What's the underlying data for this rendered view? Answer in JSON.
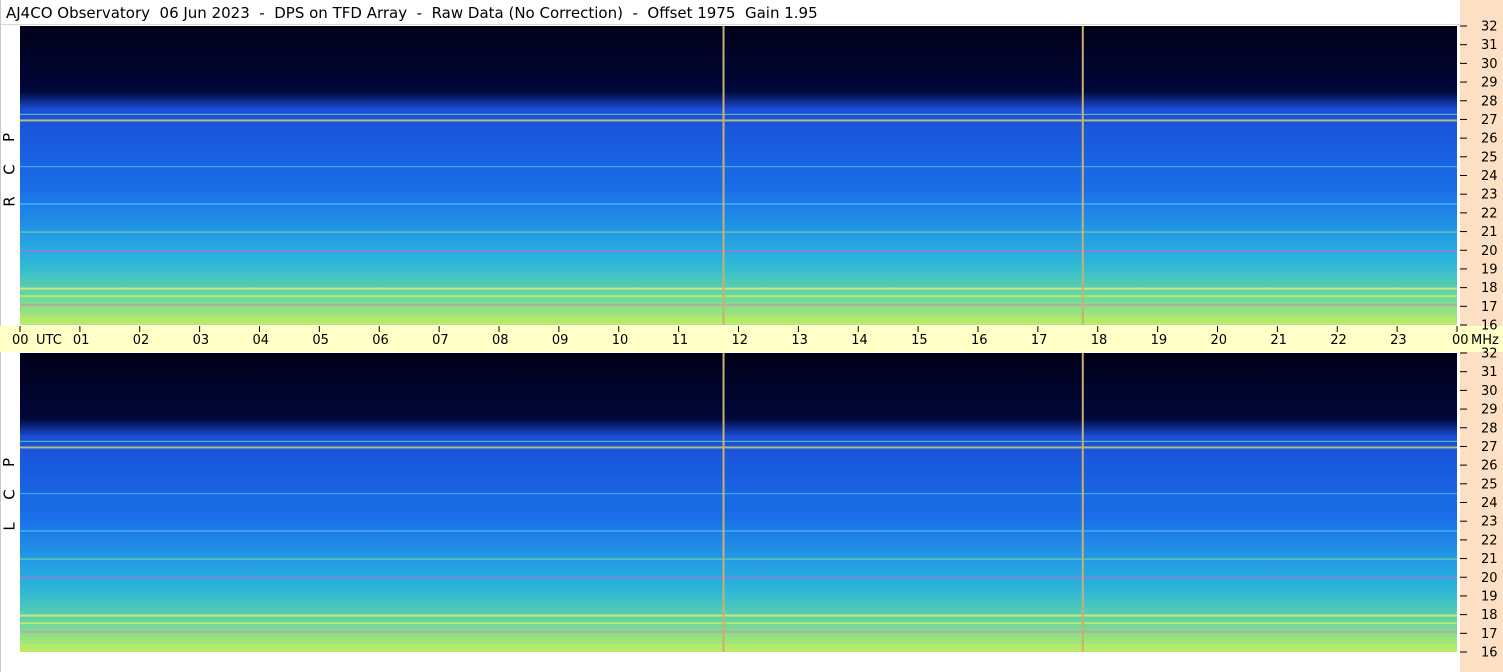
{
  "header": {
    "title": "AJ4CO Observatory  06 Jun 2023  -  DPS on TFD Array  -  Raw Data (No Correction)  -  Offset 1975  Gain 1.95"
  },
  "chart_data": {
    "type": "heatmap",
    "panels": [
      {
        "label_letters": [
          "R",
          "C",
          "P"
        ]
      },
      {
        "label_letters": [
          "L",
          "C",
          "P"
        ]
      }
    ],
    "x_axis": {
      "units_label": "UTC",
      "end_units_label": "MHz",
      "range_hours": [
        0,
        24
      ],
      "ticks": [
        "00",
        "01",
        "02",
        "03",
        "04",
        "05",
        "06",
        "07",
        "08",
        "09",
        "10",
        "11",
        "12",
        "13",
        "14",
        "15",
        "16",
        "17",
        "18",
        "19",
        "20",
        "21",
        "22",
        "23",
        "00"
      ]
    },
    "y_axis": {
      "range_mhz": [
        16,
        32
      ],
      "ticks": [
        "32",
        "31",
        "30",
        "29",
        "28",
        "27",
        "26",
        "25",
        "24",
        "23",
        "22",
        "21",
        "20",
        "19",
        "18",
        "17",
        "16"
      ]
    },
    "markers_utc_hours": [
      11.75,
      17.75
    ],
    "colors": {
      "time_axis_background": "#ffffc8",
      "freq_scale_background": "#fde0c4",
      "marker": "#c8b070"
    }
  }
}
